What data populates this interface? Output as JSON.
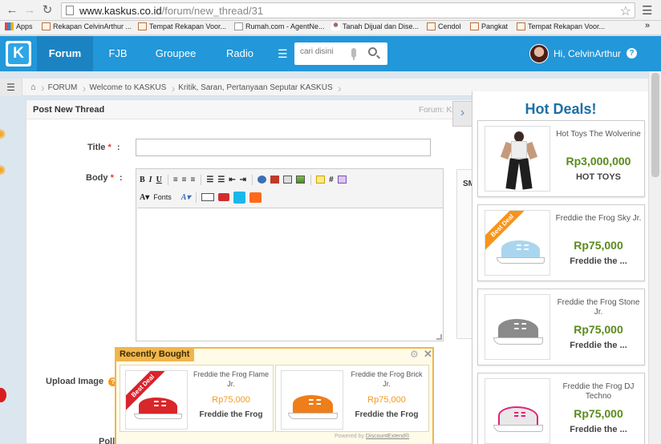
{
  "browser": {
    "url_host": "www.kaskus.co.id",
    "url_path": "/forum/new_thread/31",
    "bookmarks": [
      {
        "label": "Apps",
        "icon": "apps-icon"
      },
      {
        "label": "Rekapan CelvinArthur ...",
        "icon": "bookmark-icon"
      },
      {
        "label": "Tempat Rekapan Voor...",
        "icon": "bookmark-icon"
      },
      {
        "label": "Rumah.com - AgentNe...",
        "icon": "page-icon"
      },
      {
        "label": "Tanah Dijual dan Dise...",
        "icon": "person-icon"
      },
      {
        "label": "Cendol",
        "icon": "bookmark-icon"
      },
      {
        "label": "Pangkat",
        "icon": "bookmark-icon"
      },
      {
        "label": "Tempat Rekapan Voor...",
        "icon": "bookmark-icon"
      }
    ],
    "more_bookmarks": "»"
  },
  "navbar": {
    "logo": "K",
    "tabs": [
      {
        "label": "Forum",
        "active": true
      },
      {
        "label": "FJB",
        "active": false
      },
      {
        "label": "Groupee",
        "active": false
      },
      {
        "label": "Radio",
        "active": false
      }
    ],
    "search_placeholder": "cari disini",
    "greeting": "Hi, CelvinArthur",
    "help": "?"
  },
  "breadcrumb": {
    "items": [
      "FORUM",
      "Welcome to KASKUS",
      "Kritik, Saran, Pertanyaan Seputar KASKUS"
    ]
  },
  "form": {
    "header": "Post New Thread",
    "forum_label": "Forum:  Kritik",
    "title_label": "Title",
    "body_label": "Body",
    "upload_label": "Upload Image",
    "poll_label": "Poll",
    "required_mark": "*",
    "colon": ":",
    "toolbar": {
      "bold": "B",
      "italic": "I",
      "underline": "U",
      "hash": "#",
      "font_color": "A",
      "fonts": "Fonts",
      "font_size": "A"
    },
    "side_box_label": "SM"
  },
  "recently_bought": {
    "title": "Recently Bought",
    "items": [
      {
        "name": "Freddie the Frog Flame Jr.",
        "price": "Rp75,000",
        "brand": "Freddie the Frog",
        "badge": "Best Deal",
        "shoe_color": "#d8262a"
      },
      {
        "name": "Freddie the Frog Brick Jr.",
        "price": "Rp75,000",
        "brand": "Freddie the Frog",
        "badge": "",
        "shoe_color": "#ef7d1a"
      }
    ],
    "powered": "Powered by",
    "powered_link": "DiscountExtend®"
  },
  "hot_deals": {
    "title": "Hot Deals!",
    "items": [
      {
        "name": "Hot Toys The Wolverine",
        "price": "Rp3,000,000",
        "brand": "HOT TOYS",
        "badge": ""
      },
      {
        "name": "Freddie the Frog Sky Jr.",
        "price": "Rp75,000",
        "brand": "Freddie the ...",
        "badge": "Best Deal",
        "shoe_color": "#a9d6ee"
      },
      {
        "name": "Freddie the Frog Stone Jr.",
        "price": "Rp75,000",
        "brand": "Freddie the ...",
        "badge": "",
        "shoe_color": "#8a8a8a"
      },
      {
        "name": "Freddie the Frog DJ Techno",
        "price": "Rp75,000",
        "brand": "Freddie the ...",
        "badge": "",
        "shoe_color": "#e8e8e8"
      }
    ]
  }
}
